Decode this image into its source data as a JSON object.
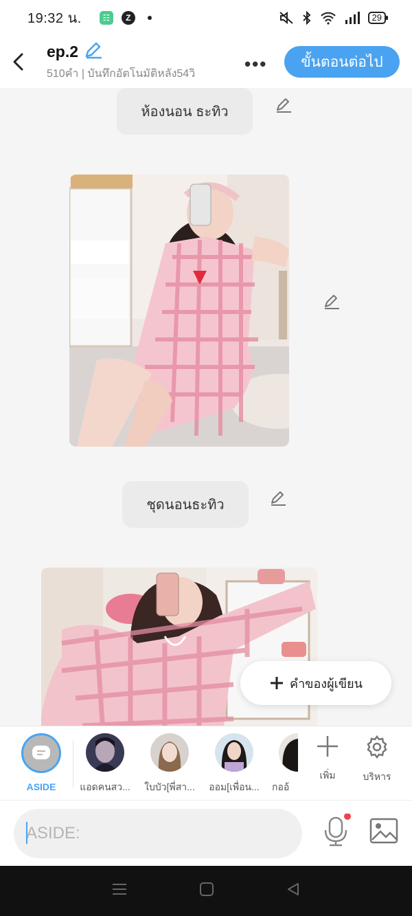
{
  "status": {
    "time": "19:32 น.",
    "battery": "29"
  },
  "header": {
    "title": "ep.2",
    "subtitle": "510คำ | บันทึกอัตโนมัติหลัง54วิ",
    "more": "•••",
    "next_label": "ขั้นตอนต่อไป"
  },
  "content": {
    "bubbles": [
      {
        "text": "ห้องนอน ธะทิว"
      },
      {
        "text": "ชุดนอนธะทิว"
      }
    ],
    "fab_label": "คำของผู้เขียน"
  },
  "characters": [
    {
      "label": "ASIDE",
      "selected": true
    },
    {
      "label": "แอดคนสว..."
    },
    {
      "label": "ใบบัว[พี่สา..."
    },
    {
      "label": "ออม[เพื่อน..."
    },
    {
      "label": "กออ้"
    }
  ],
  "tools": {
    "add_label": "เพิ่ม",
    "manage_label": "บริหาร"
  },
  "input": {
    "placeholder": "ASIDE:"
  },
  "colors": {
    "accent": "#4aa3f0",
    "background": "#f5f5f5"
  }
}
